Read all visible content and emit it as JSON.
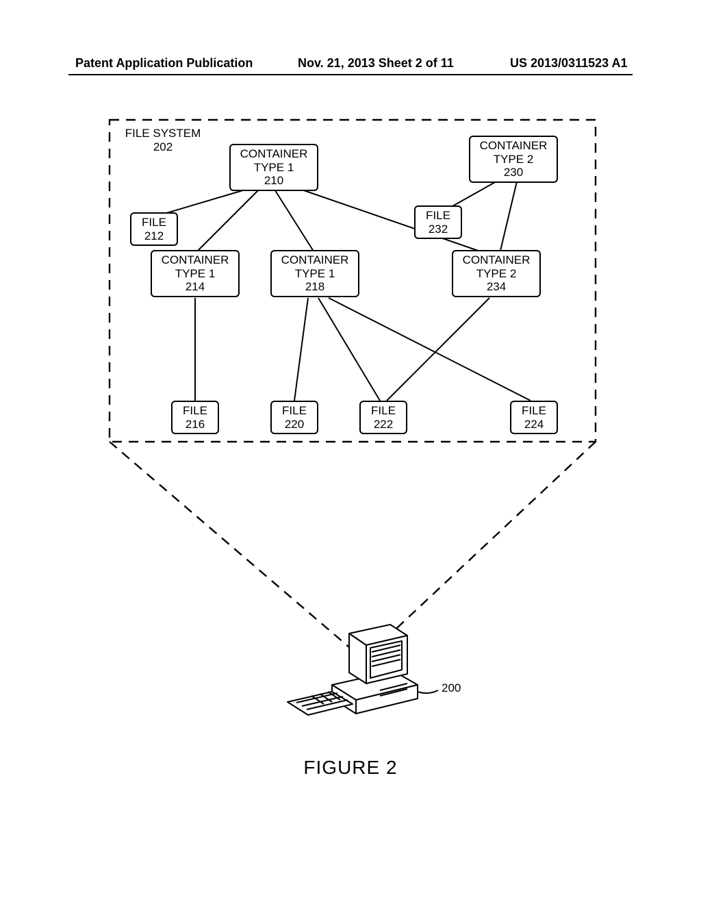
{
  "header": {
    "left": "Patent Application Publication",
    "center": "Nov. 21, 2013  Sheet 2 of 11",
    "right": "US 2013/0311523 A1"
  },
  "figure_caption": "FIGURE 2",
  "nodes": {
    "file_system": {
      "line1": "FILE SYSTEM",
      "num": "202"
    },
    "container_210": {
      "line1": "CONTAINER",
      "line2": "TYPE 1",
      "num": "210"
    },
    "container_230": {
      "line1": "CONTAINER",
      "line2": "TYPE 2",
      "num": "230"
    },
    "file_212": {
      "line1": "FILE",
      "num": "212"
    },
    "file_232": {
      "line1": "FILE",
      "num": "232"
    },
    "container_214": {
      "line1": "CONTAINER",
      "line2": "TYPE 1",
      "num": "214"
    },
    "container_218": {
      "line1": "CONTAINER",
      "line2": "TYPE 1",
      "num": "218"
    },
    "container_234": {
      "line1": "CONTAINER",
      "line2": "TYPE 2",
      "num": "234"
    },
    "file_216": {
      "line1": "FILE",
      "num": "216"
    },
    "file_220": {
      "line1": "FILE",
      "num": "220"
    },
    "file_222": {
      "line1": "FILE",
      "num": "222"
    },
    "file_224": {
      "line1": "FILE",
      "num": "224"
    },
    "computer_ref": "200"
  },
  "chart_data": {
    "type": "graph",
    "title": "FIGURE 2",
    "nodes": [
      {
        "id": "202",
        "label": "FILE SYSTEM"
      },
      {
        "id": "210",
        "label": "CONTAINER TYPE 1"
      },
      {
        "id": "230",
        "label": "CONTAINER TYPE 2"
      },
      {
        "id": "212",
        "label": "FILE"
      },
      {
        "id": "232",
        "label": "FILE"
      },
      {
        "id": "214",
        "label": "CONTAINER TYPE 1"
      },
      {
        "id": "218",
        "label": "CONTAINER TYPE 1"
      },
      {
        "id": "234",
        "label": "CONTAINER TYPE 2"
      },
      {
        "id": "216",
        "label": "FILE"
      },
      {
        "id": "220",
        "label": "FILE"
      },
      {
        "id": "222",
        "label": "FILE"
      },
      {
        "id": "224",
        "label": "FILE"
      },
      {
        "id": "200",
        "label": "Computer"
      }
    ],
    "edges": [
      {
        "from": "210",
        "to": "212"
      },
      {
        "from": "210",
        "to": "214"
      },
      {
        "from": "210",
        "to": "218"
      },
      {
        "from": "210",
        "to": "234"
      },
      {
        "from": "230",
        "to": "232"
      },
      {
        "from": "230",
        "to": "234"
      },
      {
        "from": "214",
        "to": "216"
      },
      {
        "from": "218",
        "to": "220"
      },
      {
        "from": "218",
        "to": "222"
      },
      {
        "from": "218",
        "to": "224"
      },
      {
        "from": "234",
        "to": "222"
      },
      {
        "from": "202",
        "to": "200",
        "style": "projection"
      }
    ]
  }
}
